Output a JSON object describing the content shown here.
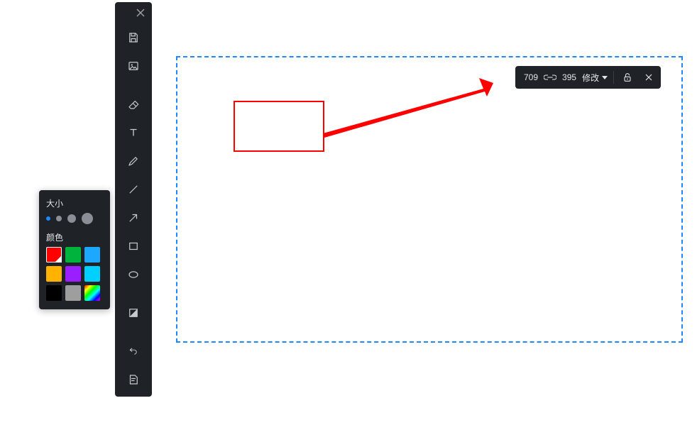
{
  "options": {
    "size_label": "大小",
    "color_label": "颜色",
    "sizes": [
      {
        "selected": true
      },
      {
        "selected": false
      },
      {
        "selected": false
      },
      {
        "selected": false
      }
    ],
    "colors": [
      {
        "hex": "#ff0000",
        "selected": true
      },
      {
        "hex": "#00b33c",
        "selected": false
      },
      {
        "hex": "#1ea7ff",
        "selected": false
      },
      {
        "hex": "#ffb300",
        "selected": false
      },
      {
        "hex": "#9b1eff",
        "selected": false
      },
      {
        "hex": "#00d0ff",
        "selected": false
      },
      {
        "hex": "#000000",
        "selected": false
      },
      {
        "hex": "#9e9e9e",
        "selected": false
      },
      {
        "hex": "rainbow",
        "selected": false
      }
    ]
  },
  "size_bar": {
    "width": "709",
    "height": "395",
    "modify_label": "修改"
  },
  "toolbar": {
    "tools": [
      "save-icon",
      "image-icon",
      "eraser-icon",
      "text-icon",
      "pencil-icon",
      "line-icon",
      "arrow-icon",
      "rectangle-icon",
      "ellipse-icon",
      "contrast-icon",
      "undo-icon",
      "sticker-icon"
    ]
  },
  "canvas": {
    "annotation_color": "#ff0000"
  }
}
